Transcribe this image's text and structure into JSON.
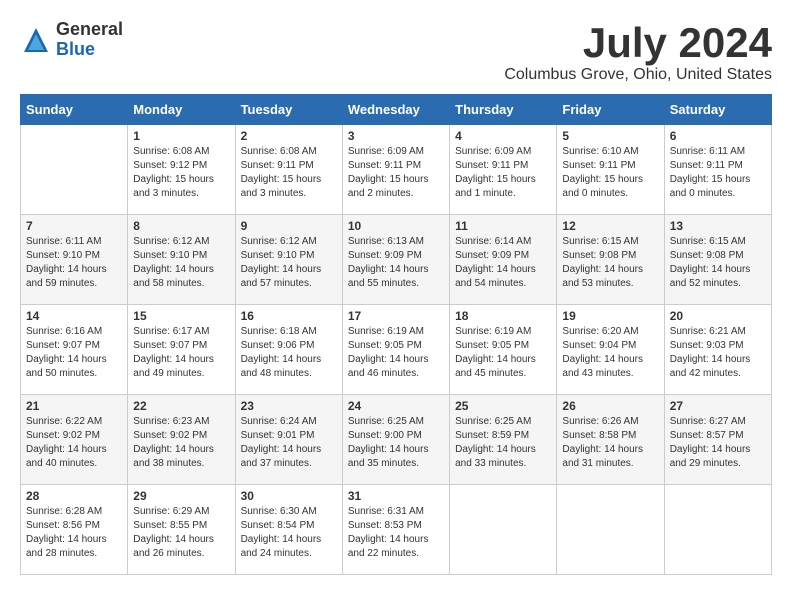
{
  "header": {
    "logo_general": "General",
    "logo_blue": "Blue",
    "month_title": "July 2024",
    "location": "Columbus Grove, Ohio, United States"
  },
  "days_of_week": [
    "Sunday",
    "Monday",
    "Tuesday",
    "Wednesday",
    "Thursday",
    "Friday",
    "Saturday"
  ],
  "weeks": [
    [
      {
        "day": "",
        "sunrise": "",
        "sunset": "",
        "daylight": ""
      },
      {
        "day": "1",
        "sunrise": "Sunrise: 6:08 AM",
        "sunset": "Sunset: 9:12 PM",
        "daylight": "Daylight: 15 hours and 3 minutes."
      },
      {
        "day": "2",
        "sunrise": "Sunrise: 6:08 AM",
        "sunset": "Sunset: 9:11 PM",
        "daylight": "Daylight: 15 hours and 3 minutes."
      },
      {
        "day": "3",
        "sunrise": "Sunrise: 6:09 AM",
        "sunset": "Sunset: 9:11 PM",
        "daylight": "Daylight: 15 hours and 2 minutes."
      },
      {
        "day": "4",
        "sunrise": "Sunrise: 6:09 AM",
        "sunset": "Sunset: 9:11 PM",
        "daylight": "Daylight: 15 hours and 1 minute."
      },
      {
        "day": "5",
        "sunrise": "Sunrise: 6:10 AM",
        "sunset": "Sunset: 9:11 PM",
        "daylight": "Daylight: 15 hours and 0 minutes."
      },
      {
        "day": "6",
        "sunrise": "Sunrise: 6:11 AM",
        "sunset": "Sunset: 9:11 PM",
        "daylight": "Daylight: 15 hours and 0 minutes."
      }
    ],
    [
      {
        "day": "7",
        "sunrise": "Sunrise: 6:11 AM",
        "sunset": "Sunset: 9:10 PM",
        "daylight": "Daylight: 14 hours and 59 minutes."
      },
      {
        "day": "8",
        "sunrise": "Sunrise: 6:12 AM",
        "sunset": "Sunset: 9:10 PM",
        "daylight": "Daylight: 14 hours and 58 minutes."
      },
      {
        "day": "9",
        "sunrise": "Sunrise: 6:12 AM",
        "sunset": "Sunset: 9:10 PM",
        "daylight": "Daylight: 14 hours and 57 minutes."
      },
      {
        "day": "10",
        "sunrise": "Sunrise: 6:13 AM",
        "sunset": "Sunset: 9:09 PM",
        "daylight": "Daylight: 14 hours and 55 minutes."
      },
      {
        "day": "11",
        "sunrise": "Sunrise: 6:14 AM",
        "sunset": "Sunset: 9:09 PM",
        "daylight": "Daylight: 14 hours and 54 minutes."
      },
      {
        "day": "12",
        "sunrise": "Sunrise: 6:15 AM",
        "sunset": "Sunset: 9:08 PM",
        "daylight": "Daylight: 14 hours and 53 minutes."
      },
      {
        "day": "13",
        "sunrise": "Sunrise: 6:15 AM",
        "sunset": "Sunset: 9:08 PM",
        "daylight": "Daylight: 14 hours and 52 minutes."
      }
    ],
    [
      {
        "day": "14",
        "sunrise": "Sunrise: 6:16 AM",
        "sunset": "Sunset: 9:07 PM",
        "daylight": "Daylight: 14 hours and 50 minutes."
      },
      {
        "day": "15",
        "sunrise": "Sunrise: 6:17 AM",
        "sunset": "Sunset: 9:07 PM",
        "daylight": "Daylight: 14 hours and 49 minutes."
      },
      {
        "day": "16",
        "sunrise": "Sunrise: 6:18 AM",
        "sunset": "Sunset: 9:06 PM",
        "daylight": "Daylight: 14 hours and 48 minutes."
      },
      {
        "day": "17",
        "sunrise": "Sunrise: 6:19 AM",
        "sunset": "Sunset: 9:05 PM",
        "daylight": "Daylight: 14 hours and 46 minutes."
      },
      {
        "day": "18",
        "sunrise": "Sunrise: 6:19 AM",
        "sunset": "Sunset: 9:05 PM",
        "daylight": "Daylight: 14 hours and 45 minutes."
      },
      {
        "day": "19",
        "sunrise": "Sunrise: 6:20 AM",
        "sunset": "Sunset: 9:04 PM",
        "daylight": "Daylight: 14 hours and 43 minutes."
      },
      {
        "day": "20",
        "sunrise": "Sunrise: 6:21 AM",
        "sunset": "Sunset: 9:03 PM",
        "daylight": "Daylight: 14 hours and 42 minutes."
      }
    ],
    [
      {
        "day": "21",
        "sunrise": "Sunrise: 6:22 AM",
        "sunset": "Sunset: 9:02 PM",
        "daylight": "Daylight: 14 hours and 40 minutes."
      },
      {
        "day": "22",
        "sunrise": "Sunrise: 6:23 AM",
        "sunset": "Sunset: 9:02 PM",
        "daylight": "Daylight: 14 hours and 38 minutes."
      },
      {
        "day": "23",
        "sunrise": "Sunrise: 6:24 AM",
        "sunset": "Sunset: 9:01 PM",
        "daylight": "Daylight: 14 hours and 37 minutes."
      },
      {
        "day": "24",
        "sunrise": "Sunrise: 6:25 AM",
        "sunset": "Sunset: 9:00 PM",
        "daylight": "Daylight: 14 hours and 35 minutes."
      },
      {
        "day": "25",
        "sunrise": "Sunrise: 6:25 AM",
        "sunset": "Sunset: 8:59 PM",
        "daylight": "Daylight: 14 hours and 33 minutes."
      },
      {
        "day": "26",
        "sunrise": "Sunrise: 6:26 AM",
        "sunset": "Sunset: 8:58 PM",
        "daylight": "Daylight: 14 hours and 31 minutes."
      },
      {
        "day": "27",
        "sunrise": "Sunrise: 6:27 AM",
        "sunset": "Sunset: 8:57 PM",
        "daylight": "Daylight: 14 hours and 29 minutes."
      }
    ],
    [
      {
        "day": "28",
        "sunrise": "Sunrise: 6:28 AM",
        "sunset": "Sunset: 8:56 PM",
        "daylight": "Daylight: 14 hours and 28 minutes."
      },
      {
        "day": "29",
        "sunrise": "Sunrise: 6:29 AM",
        "sunset": "Sunset: 8:55 PM",
        "daylight": "Daylight: 14 hours and 26 minutes."
      },
      {
        "day": "30",
        "sunrise": "Sunrise: 6:30 AM",
        "sunset": "Sunset: 8:54 PM",
        "daylight": "Daylight: 14 hours and 24 minutes."
      },
      {
        "day": "31",
        "sunrise": "Sunrise: 6:31 AM",
        "sunset": "Sunset: 8:53 PM",
        "daylight": "Daylight: 14 hours and 22 minutes."
      },
      {
        "day": "",
        "sunrise": "",
        "sunset": "",
        "daylight": ""
      },
      {
        "day": "",
        "sunrise": "",
        "sunset": "",
        "daylight": ""
      },
      {
        "day": "",
        "sunrise": "",
        "sunset": "",
        "daylight": ""
      }
    ]
  ]
}
